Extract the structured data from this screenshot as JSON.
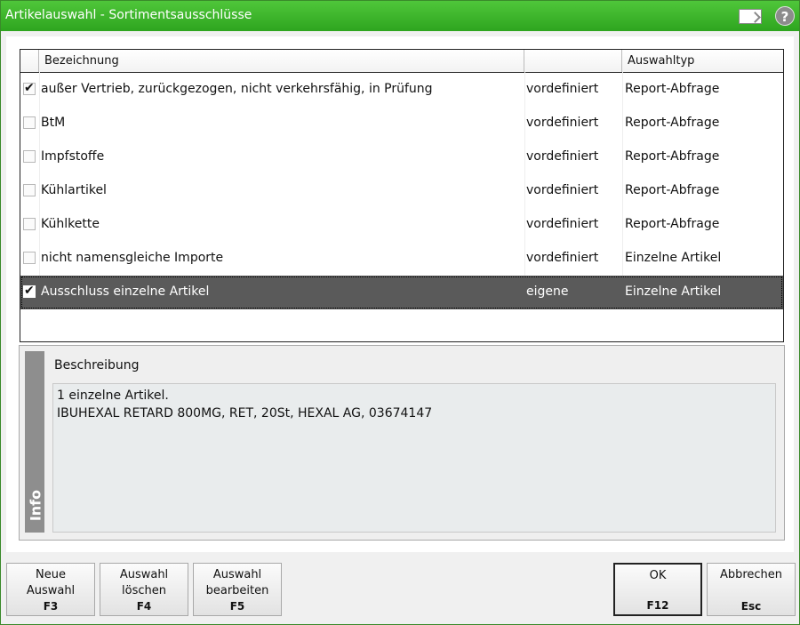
{
  "window": {
    "title": "Artikelauswahl - Sortimentsausschlüsse",
    "icons": [
      "note-icon",
      "help-icon"
    ],
    "help_glyph": "?"
  },
  "grid": {
    "columns": [
      "",
      "Bezeichnung",
      "",
      "Auswahltyp"
    ],
    "rows": [
      {
        "checked": true,
        "bezeichnung": "außer Vertrieb, zurückgezogen, nicht verkehrsfähig, in Prüfung",
        "quelle": "vordefiniert",
        "auswahltyp": "Report-Abfrage"
      },
      {
        "checked": false,
        "bezeichnung": "BtM",
        "quelle": "vordefiniert",
        "auswahltyp": "Report-Abfrage"
      },
      {
        "checked": false,
        "bezeichnung": "Impfstoffe",
        "quelle": "vordefiniert",
        "auswahltyp": "Report-Abfrage"
      },
      {
        "checked": false,
        "bezeichnung": "Kühlartikel",
        "quelle": "vordefiniert",
        "auswahltyp": "Report-Abfrage"
      },
      {
        "checked": false,
        "bezeichnung": "Kühlkette",
        "quelle": "vordefiniert",
        "auswahltyp": "Report-Abfrage"
      },
      {
        "checked": false,
        "bezeichnung": "nicht namensgleiche Importe",
        "quelle": "vordefiniert",
        "auswahltyp": "Einzelne Artikel"
      },
      {
        "checked": true,
        "selected": true,
        "bezeichnung": "Ausschluss einzelne Artikel",
        "quelle": "eigene",
        "auswahltyp": "Einzelne Artikel"
      }
    ]
  },
  "info": {
    "tab_label": "Info",
    "description_label": "Beschreibung",
    "description_lines": [
      "1 einzelne Artikel.",
      "IBUHEXAL RETARD 800MG, RET, 20St, HEXAL AG, 03674147"
    ]
  },
  "buttons": [
    {
      "name": "neue-auswahl-button",
      "lines": [
        "Neue",
        "Auswahl"
      ],
      "key": "F3"
    },
    {
      "name": "auswahl-loeschen-button",
      "lines": [
        "Auswahl",
        "löschen"
      ],
      "key": "F4"
    },
    {
      "name": "auswahl-bearbeiten-button",
      "lines": [
        "Auswahl",
        "bearbeiten"
      ],
      "key": "F5"
    },
    {
      "name": "ok-button",
      "lines": [
        "OK"
      ],
      "key": "F12",
      "default": true
    },
    {
      "name": "abbrechen-button",
      "lines": [
        "Abbrechen"
      ],
      "key": "Esc"
    }
  ]
}
